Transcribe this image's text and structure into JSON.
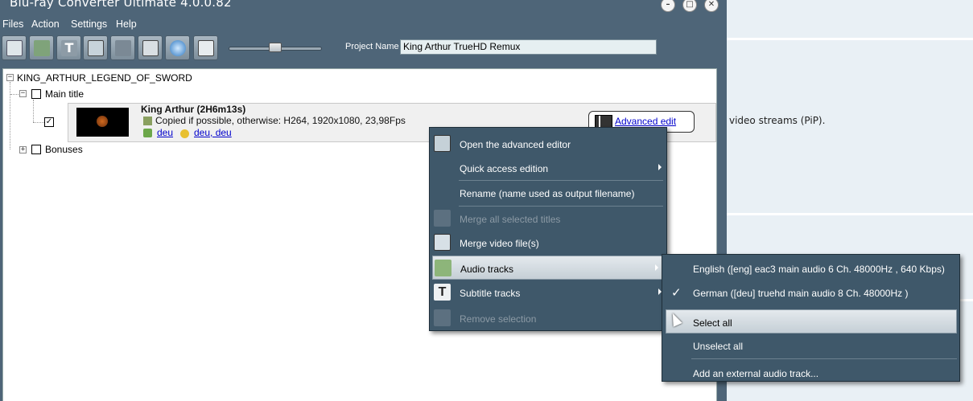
{
  "window": {
    "title": "Blu-ray Converter Ultimate 4.0.0.82"
  },
  "menubar": {
    "items": [
      "Files",
      "Action",
      "Settings",
      "Help"
    ]
  },
  "toolbar": {
    "project_name_label": "Project Name",
    "project_name_value": "King Arthur TrueHD Remux",
    "buttons": [
      "add-title-icon",
      "add-audio-icon",
      "add-subtitle-icon",
      "merge-video-icon",
      "remove-icon",
      "settings-icon",
      "convert-icon",
      "preview-icon"
    ]
  },
  "tree": {
    "root_label": "KING_ARTHUR_LEGEND_OF_SWORD",
    "main_title_label": "Main title",
    "bonuses_label": "Bonuses",
    "title": {
      "name": "King Arthur (2H6m13s)",
      "desc": "Copied if possible, otherwise: H264, 1920x1080, 23,98Fps",
      "audio_link": "deu",
      "subtitle_link": "deu, deu",
      "advanced_edit": "Advanced edit",
      "checked": true
    }
  },
  "context_menu": {
    "items": [
      {
        "label": "Open the advanced editor",
        "enabled": true
      },
      {
        "label": "Quick access edition",
        "enabled": true,
        "submenu": true
      },
      {
        "label": "Rename (name used as output filename)",
        "enabled": true
      },
      {
        "label": "Merge all selected titles",
        "enabled": false
      },
      {
        "label": "Merge video file(s)",
        "enabled": true
      },
      {
        "label": "Audio tracks",
        "enabled": true,
        "submenu": true,
        "highlighted": true
      },
      {
        "label": "Subtitle tracks",
        "enabled": true,
        "submenu": true
      },
      {
        "label": "Remove selection",
        "enabled": false
      }
    ]
  },
  "audio_submenu": {
    "items": [
      {
        "label": "English ([eng] eac3 main audio 6 Ch. 48000Hz , 640 Kbps)",
        "checked": false
      },
      {
        "label": "German ([deu] truehd main audio 8 Ch. 48000Hz )",
        "checked": true
      },
      {
        "label": "Select all",
        "highlighted": true
      },
      {
        "label": "Unselect all"
      },
      {
        "label": "Add an external audio track..."
      }
    ]
  },
  "background_app": {
    "text": "video streams (PiP)."
  },
  "colors": {
    "window_bg": "#4e6578",
    "menu_bg": "#3f586a",
    "link": "#0000cc"
  }
}
